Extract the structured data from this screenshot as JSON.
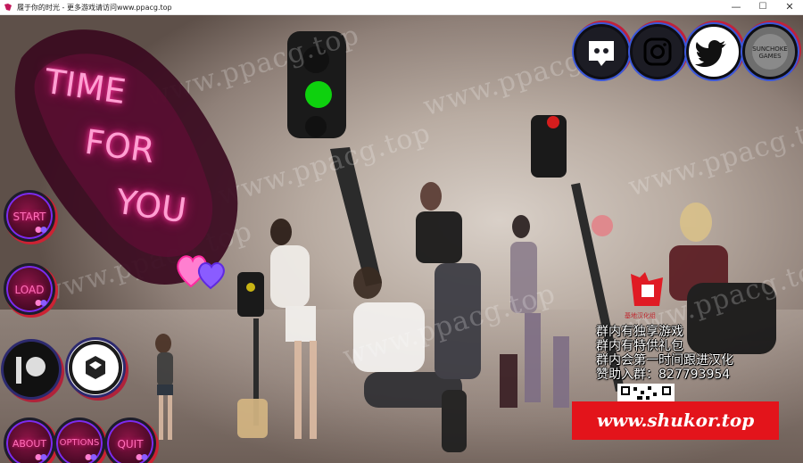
{
  "window": {
    "title": "履于你的时光 - 更多游戏请访问www.ppacg.top",
    "controls": [
      "—",
      "☐",
      "✕"
    ]
  },
  "watermark": "www.ppacg.top",
  "logo": {
    "lines": [
      "TIME",
      "FOR",
      "YOU"
    ],
    "color": "#ff9fd2"
  },
  "menu": {
    "start": "START",
    "load": "LOAD",
    "about": "ABOUT",
    "options": "OPTIONS",
    "quit": "QUIT"
  },
  "social": [
    {
      "name": "discord",
      "icon": "discord-icon"
    },
    {
      "name": "instagram",
      "icon": "instagram-icon"
    },
    {
      "name": "twitter",
      "icon": "twitter-icon"
    },
    {
      "name": "sunchoke-games",
      "icon": "sunchoke-logo-icon",
      "text": "SUNCHOKE GAMES"
    }
  ],
  "promo": {
    "lines": [
      "群内有独享游戏",
      "群内有特供礼包",
      "群内会第一时间跟进汉化",
      "赞助入群：827793954"
    ],
    "url": "www.shukor.top",
    "badge": "基地汉化组"
  },
  "colors": {
    "neon_pink": "#ff1a8c",
    "banner_red": "#e3141b",
    "ring_blue": "#3b57d9"
  }
}
